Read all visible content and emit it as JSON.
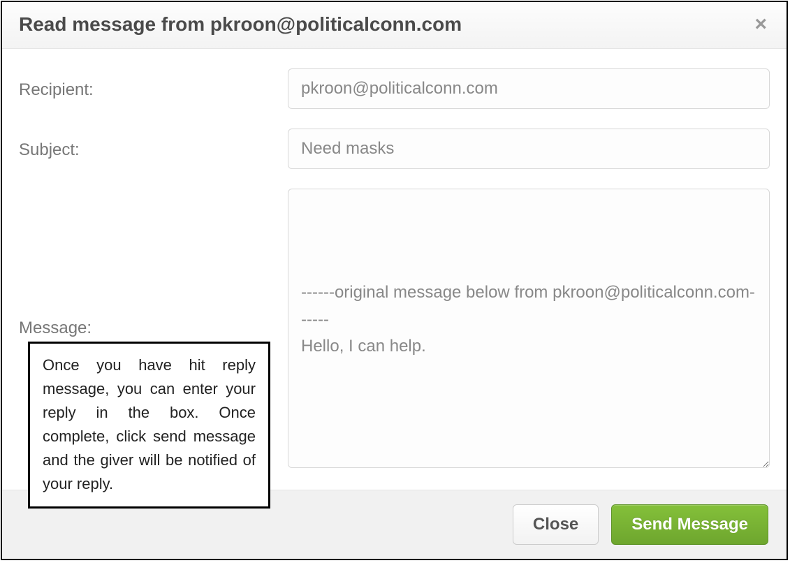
{
  "header": {
    "title": "Read message from pkroon@politicalconn.com"
  },
  "form": {
    "recipient_label": "Recipient:",
    "recipient_value": "pkroon@politicalconn.com",
    "subject_label": "Subject:",
    "subject_value": "Need masks",
    "message_label": "Message:",
    "message_value": "\n\n\n------original message below from pkroon@politicalconn.com------\nHello, I can help."
  },
  "footer": {
    "close_label": "Close",
    "send_label": "Send Message"
  },
  "help": {
    "text": "Once you have hit reply message, you can enter your reply in the box. Once complete, click send message and the giver will be notified of your reply."
  }
}
